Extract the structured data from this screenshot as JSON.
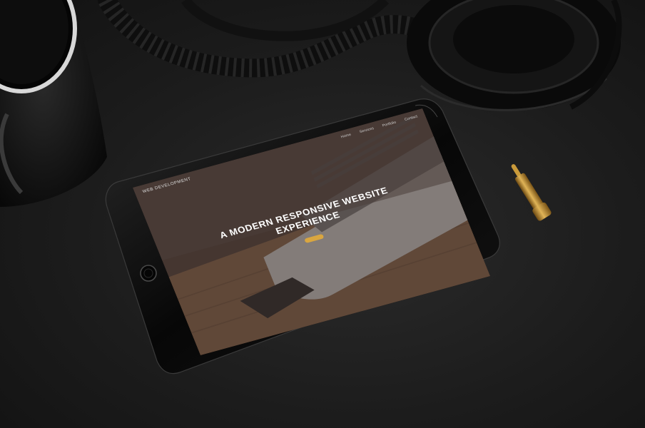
{
  "site": {
    "brand": "Web Development",
    "nav": [
      "Home",
      "Services",
      "Portfolio",
      "Contact"
    ],
    "hero_title_line1": "A MODERN RESPONSIVE WEBSITE",
    "hero_title_line2": "EXPERIENCE",
    "hero_subtitle": "",
    "cta_label": ""
  },
  "colors": {
    "background": "#1c1c1c",
    "tablet_bezel": "#0b0b0b",
    "hero_overlay": "#4a3e3a",
    "cta": "#d9a640",
    "desk_wood": "#6b4a30",
    "brass_plug": "#b8862a"
  },
  "icons": {
    "home_button": "tablet-home-button-icon"
  }
}
